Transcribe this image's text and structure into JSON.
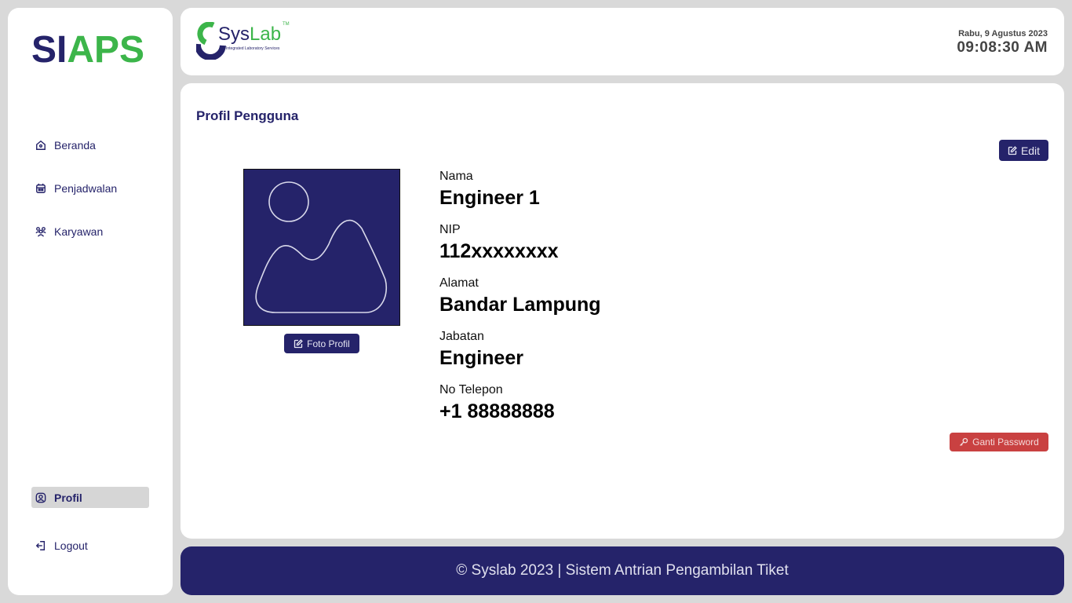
{
  "sidebar": {
    "logo_part1": "SI",
    "logo_part2": "APS",
    "items": [
      {
        "label": "Beranda",
        "icon": "home-icon"
      },
      {
        "label": "Penjadwalan",
        "icon": "calendar-icon"
      },
      {
        "label": "Karyawan",
        "icon": "users-icon"
      },
      {
        "label": "Profil",
        "icon": "user-circle-icon"
      },
      {
        "label": "Logout",
        "icon": "logout-icon"
      }
    ]
  },
  "header": {
    "brand_part1": "Sys",
    "brand_part2": "Lab",
    "brand_tm": "TM",
    "brand_subtitle": "Integrated Laboratory Services",
    "date": "Rabu, 9 Agustus 2023",
    "time": "09:08:30 AM"
  },
  "main": {
    "title": "Profil Pengguna",
    "edit_label": "Edit",
    "photo_button_label": "Foto Profil",
    "password_button_label": "Ganti Password",
    "fields": [
      {
        "label": "Nama",
        "value": "Engineer 1"
      },
      {
        "label": "NIP",
        "value": "112xxxxxxxx"
      },
      {
        "label": "Alamat",
        "value": "Bandar Lampung"
      },
      {
        "label": "Jabatan",
        "value": "Engineer"
      },
      {
        "label": "No Telepon",
        "value": "+1 88888888"
      }
    ]
  },
  "footer": {
    "text": "© Syslab 2023 | Sistem Antrian Pengambilan Tiket"
  },
  "colors": {
    "primary": "#25236a",
    "accent": "#3cb54a",
    "danger": "#c94141",
    "background": "#d9d9d9"
  }
}
